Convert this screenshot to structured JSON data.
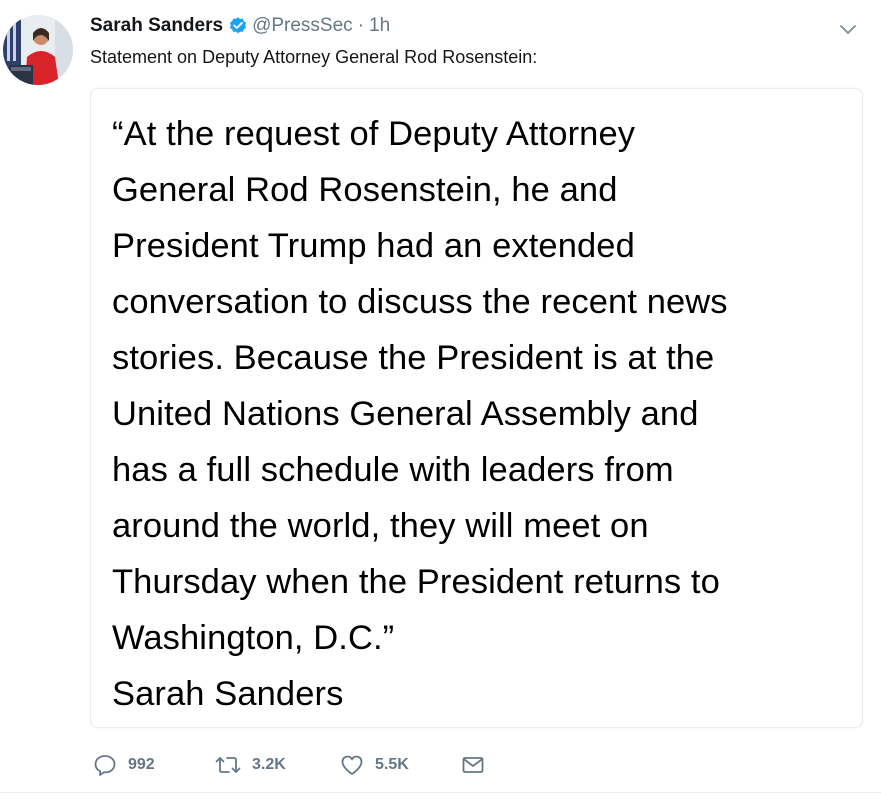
{
  "tweet": {
    "author": {
      "display_name": "Sarah Sanders",
      "handle": "@PressSec",
      "separator": "·",
      "time": "1h",
      "verified_icon": "verified-badge-icon",
      "verified_color": "#1da1f2"
    },
    "text": "Statement on Deputy Attorney General Rod Rosenstein:",
    "menu_icon": "chevron-down-icon",
    "image_card": {
      "lines": [
        "“At the request of Deputy Attorney",
        "General Rod Rosenstein, he and",
        "President Trump had an extended",
        "conversation to discuss the recent news",
        "stories. Because the President is at the",
        "United Nations General Assembly and",
        "has a full schedule with leaders from",
        "around the world, they will meet on",
        "Thursday when the President returns to",
        "Washington, D.C.”",
        "Sarah Sanders"
      ]
    },
    "actions": {
      "reply": {
        "icon": "reply-icon",
        "count": "992"
      },
      "retweet": {
        "icon": "retweet-icon",
        "count": "3.2K"
      },
      "like": {
        "icon": "heart-icon",
        "count": "5.5K"
      },
      "message": {
        "icon": "envelope-icon"
      }
    },
    "colors": {
      "text": "#14171a",
      "secondary": "#657786",
      "border": "#e6ecf0"
    }
  }
}
